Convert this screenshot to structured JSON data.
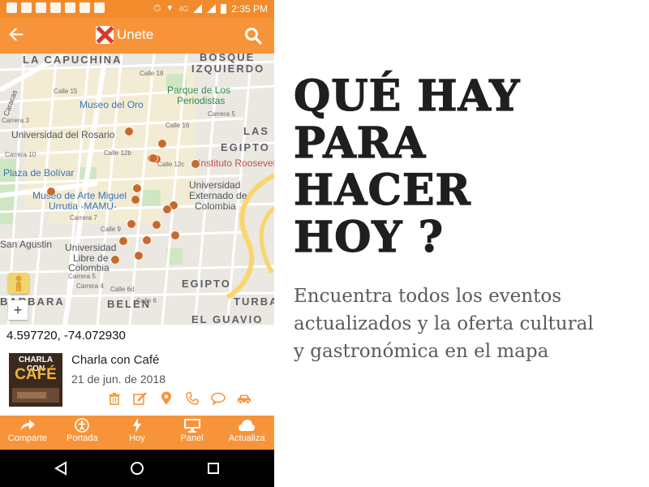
{
  "status_bar": {
    "network": "4G",
    "time": "2:35 PM"
  },
  "app_bar": {
    "title": "Unete"
  },
  "map": {
    "district_labels": [
      "LA CAPUCHINA",
      "BOSQUE",
      "IZQUIERDO",
      "LAS",
      "EGIPTO",
      "EGIPTO",
      "BELEN",
      "TURBA",
      "BARBARA",
      "EL GUAVIO"
    ],
    "place_labels": [
      "Museo del Oro",
      "Parque de Los",
      "Periodistas",
      "Universidad del Rosario",
      "Plaza de Bolívar",
      "Museo de Arte Miguel",
      "Urrutia -MAMU-",
      "Universidad",
      "Externado de",
      "Colombia",
      "Universidad",
      "Libre de",
      "Colombia",
      "Instituto Roosevel",
      "San Agustin",
      "Caracas"
    ],
    "street_labels": [
      "Calle 15",
      "Calle 18",
      "Carrera 5",
      "Calle 16",
      "Carrera 3",
      "Calle 12b",
      "Calle 12c",
      "Carrera 10",
      "Carrera 7",
      "Calle 9",
      "Carrera 4",
      "Carrera 5",
      "Calle 6d",
      "Calle 6"
    ]
  },
  "location": {
    "coordinates": "4.597720, -74.072930"
  },
  "event": {
    "title": "Charla con Café",
    "date": "21 de jun. de 2018",
    "thumbnail": {
      "line1": "CHARLA CON",
      "line2": "CAFÉ"
    },
    "actions": [
      "delete-icon",
      "edit-icon",
      "location-pin-icon",
      "phone-icon",
      "chat-icon",
      "car-icon"
    ]
  },
  "bottom_nav": [
    {
      "label": "Comparte",
      "icon": "share-icon"
    },
    {
      "label": "Portada",
      "icon": "accessibility-icon"
    },
    {
      "label": "Hoy",
      "icon": "lightning-icon"
    },
    {
      "label": "Panel",
      "icon": "monitor-icon"
    },
    {
      "label": "Actualiza",
      "icon": "cloud-icon"
    }
  ],
  "promo": {
    "headline": [
      "QUÉ HAY",
      "PARA",
      "HACER",
      "HOY ?"
    ],
    "description": [
      "Encuentra todos los eventos",
      "actualizados y la oferta cultural",
      "y gastronómica en el mapa"
    ]
  },
  "colors": {
    "accent": "#f7943a",
    "status_bar": "#f28b2c",
    "event_dot": "#c76a2d"
  }
}
